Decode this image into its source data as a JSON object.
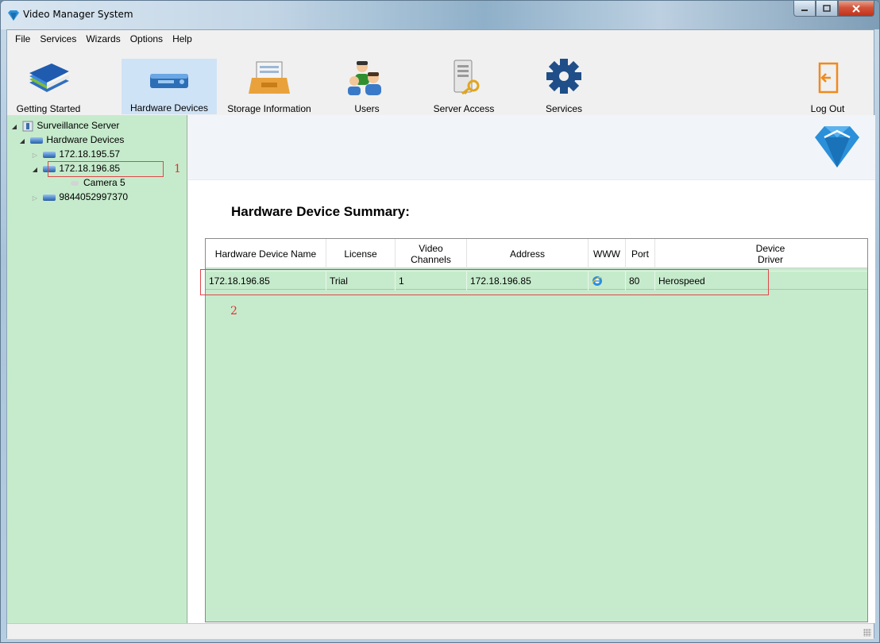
{
  "window": {
    "title": "Video Manager System"
  },
  "menu": [
    "File",
    "Services",
    "Wizards",
    "Options",
    "Help"
  ],
  "toolbar": {
    "getting_started": "Getting Started",
    "hardware_devices": "Hardware Devices",
    "storage_information": "Storage Information",
    "users": "Users",
    "server_access": "Server Access",
    "services": "Services",
    "log_out": "Log Out"
  },
  "tree": {
    "root": "Surveillance Server",
    "group": "Hardware Devices",
    "device1": "172.18.195.57",
    "device2": "172.18.196.85",
    "camera": "Camera 5",
    "device3": "9844052997370",
    "annotation1": "1"
  },
  "summary": {
    "title": "Hardware Device Summary:",
    "headers": {
      "name": "Hardware Device Name",
      "license": "License",
      "video": "Video",
      "channels": "Channels",
      "address": "Address",
      "www": "WWW",
      "port": "Port",
      "device": "Device",
      "driver": "Driver"
    },
    "row": {
      "name": "172.18.196.85",
      "license": "Trial",
      "channels": "1",
      "address": "172.18.196.85",
      "port": "80",
      "driver": "Herospeed"
    },
    "annotation2": "2"
  },
  "colors": {
    "accent": "#2b90d9",
    "panel_green": "#c6ebcc",
    "annotation_red": "#e03030"
  },
  "icons": [
    "app-logo-icon",
    "book-icon",
    "nvr-icon",
    "storage-tray-icon",
    "users-icon",
    "server-key-icon",
    "gear-icon",
    "logout-icon",
    "ie-icon"
  ]
}
